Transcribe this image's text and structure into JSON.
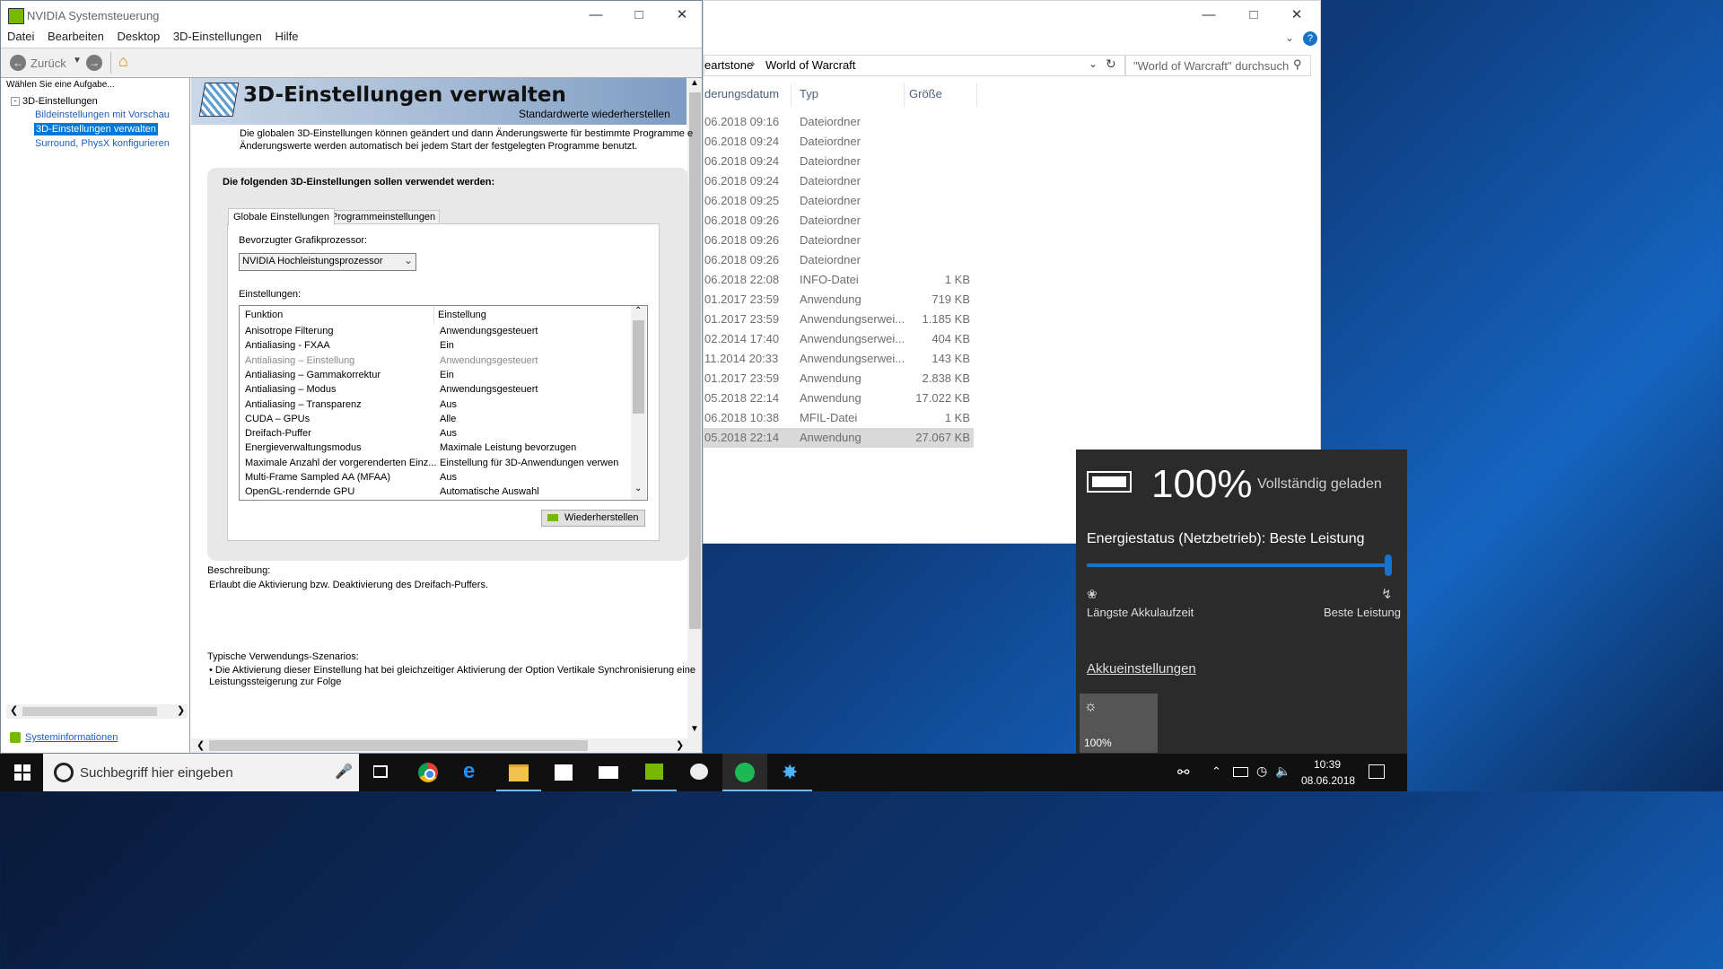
{
  "nvidia": {
    "window_title": "NVIDIA Systemsteuerung",
    "menu": [
      "Datei",
      "Bearbeiten",
      "Desktop",
      "3D-Einstellungen",
      "Hilfe"
    ],
    "back_label": "Zurück",
    "task_prompt": "Wählen Sie eine Aufgabe...",
    "tree_root": "3D-Einstellungen",
    "tree_items": [
      "Bildeinstellungen mit Vorschau anpa",
      "3D-Einstellungen verwalten",
      "Surround, PhysX konfigurieren"
    ],
    "system_info": "Systeminformationen",
    "page_title": "3D-Einstellungen verwalten",
    "restore_defaults": "Standardwerte wiederherstellen",
    "intro_line1": "Die globalen 3D-Einstellungen können geändert und dann Änderungswerte für bestimmte Programme e",
    "intro_line2": "Änderungswerte werden automatisch bei jedem Start der festgelegten Programme benutzt.",
    "panel_heading": "Die folgenden 3D-Einstellungen sollen verwendet werden:",
    "tabs": [
      "Globale Einstellungen",
      "Programmeinstellungen"
    ],
    "gpu_label": "Bevorzugter Grafikprozessor:",
    "gpu_value": "NVIDIA Hochleistungsprozessor",
    "settings_label": "Einstellungen:",
    "col_function": "Funktion",
    "col_setting": "Einstellung",
    "settings": [
      {
        "f": "Anisotrope Filterung",
        "v": "Anwendungsgesteuert",
        "dim": false
      },
      {
        "f": "Antialiasing - FXAA",
        "v": "Ein",
        "dim": false
      },
      {
        "f": "Antialiasing – Einstellung",
        "v": "Anwendungsgesteuert",
        "dim": true
      },
      {
        "f": "Antialiasing – Gammakorrektur",
        "v": "Ein",
        "dim": false
      },
      {
        "f": "Antialiasing – Modus",
        "v": "Anwendungsgesteuert",
        "dim": false
      },
      {
        "f": "Antialiasing – Transparenz",
        "v": "Aus",
        "dim": false
      },
      {
        "f": "CUDA – GPUs",
        "v": "Alle",
        "dim": false
      },
      {
        "f": "Dreifach-Puffer",
        "v": "Aus",
        "dim": false
      },
      {
        "f": "Energieverwaltungsmodus",
        "v": "Maximale Leistung bevorzugen",
        "dim": false
      },
      {
        "f": "Maximale Anzahl der vorgerenderten Einz...",
        "v": "Einstellung für 3D-Anwendungen verwen",
        "dim": false
      },
      {
        "f": "Multi-Frame Sampled AA (MFAA)",
        "v": "Aus",
        "dim": false
      },
      {
        "f": "OpenGL-rendernde GPU",
        "v": "Automatische Auswahl",
        "dim": false
      }
    ],
    "restore_button": "Wiederherstellen",
    "desc_label": "Beschreibung:",
    "desc_text": "Erlaubt die Aktivierung bzw. Deaktivierung des Dreifach-Puffers.",
    "usage_label": "Typische Verwendungs-Szenarios:",
    "usage_line1": "• Die Aktivierung dieser Einstellung hat bei gleichzeitiger Aktivierung der Option Vertikale Synchronisierung eine",
    "usage_line2": "Leistungssteigerung zur Folge"
  },
  "explorer": {
    "breadcrumb_prev": "eartstone",
    "breadcrumb_current": "World of Warcraft",
    "search_placeholder": "\"World of Warcraft\" durchsuch",
    "col_date": "derungsdatum",
    "col_type": "Typ",
    "col_size": "Größe",
    "rows": [
      {
        "d": "06.2018 09:16",
        "t": "Dateiordner",
        "s": ""
      },
      {
        "d": "06.2018 09:24",
        "t": "Dateiordner",
        "s": ""
      },
      {
        "d": "06.2018 09:24",
        "t": "Dateiordner",
        "s": ""
      },
      {
        "d": "06.2018 09:24",
        "t": "Dateiordner",
        "s": ""
      },
      {
        "d": "06.2018 09:25",
        "t": "Dateiordner",
        "s": ""
      },
      {
        "d": "06.2018 09:26",
        "t": "Dateiordner",
        "s": ""
      },
      {
        "d": "06.2018 09:26",
        "t": "Dateiordner",
        "s": ""
      },
      {
        "d": "06.2018 09:26",
        "t": "Dateiordner",
        "s": ""
      },
      {
        "d": "06.2018 22:08",
        "t": "INFO-Datei",
        "s": "1 KB"
      },
      {
        "d": "01.2017 23:59",
        "t": "Anwendung",
        "s": "719 KB"
      },
      {
        "d": "01.2017 23:59",
        "t": "Anwendungserwei...",
        "s": "1.185 KB"
      },
      {
        "d": "02.2014 17:40",
        "t": "Anwendungserwei...",
        "s": "404 KB"
      },
      {
        "d": "11.2014 20:33",
        "t": "Anwendungserwei...",
        "s": "143 KB"
      },
      {
        "d": "01.2017 23:59",
        "t": "Anwendung",
        "s": "2.838 KB"
      },
      {
        "d": "05.2018 22:14",
        "t": "Anwendung",
        "s": "17.022 KB"
      },
      {
        "d": "06.2018 10:38",
        "t": "MFIL-Datei",
        "s": "1 KB"
      },
      {
        "d": "05.2018 22:14",
        "t": "Anwendung",
        "s": "27.067 KB"
      }
    ]
  },
  "battery": {
    "percent": "100%",
    "status": "Vollständig geladen",
    "power_mode": "Energiestatus (Netzbetrieb): Beste Leistung",
    "slider_level": 1.0,
    "left_label": "Längste Akkulaufzeit",
    "right_label": "Beste Leistung",
    "settings_link": "Akkueinstellungen",
    "brightness": "100%"
  },
  "taskbar": {
    "search_placeholder": "Suchbegriff hier eingeben",
    "time": "10:39",
    "date": "08.06.2018"
  }
}
